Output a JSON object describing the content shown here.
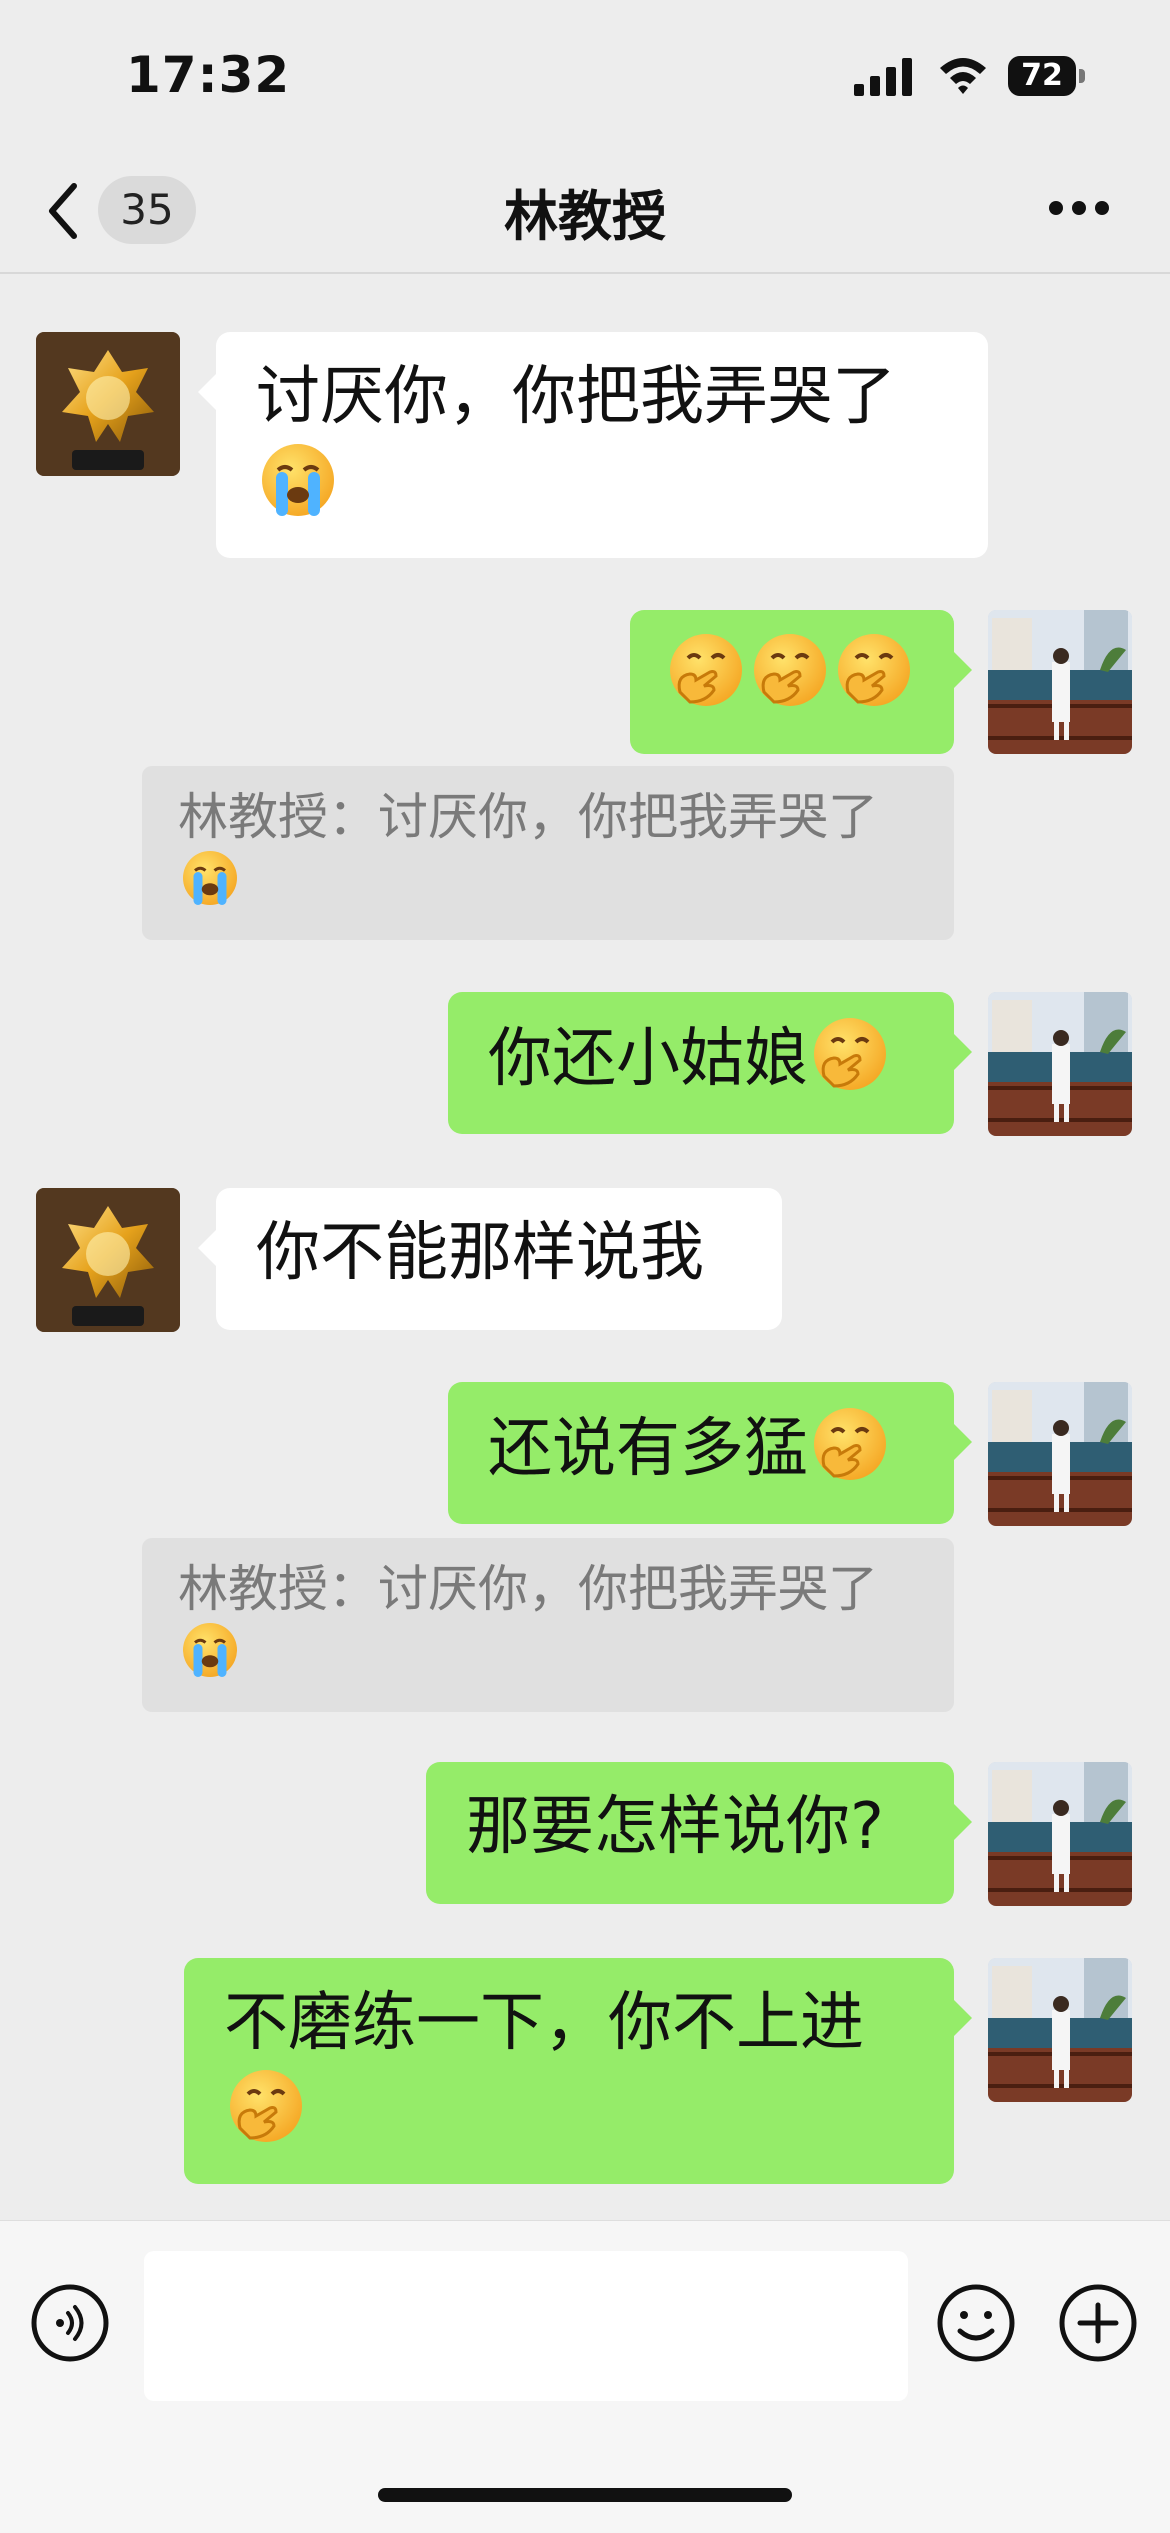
{
  "status": {
    "time": "17:32",
    "battery": "72"
  },
  "nav": {
    "unread_count": "35",
    "title": "林教授"
  },
  "messages": [
    {
      "side": "in",
      "text": "讨厌你，你把我弄哭了",
      "emoji": [
        "loudly-crying-face"
      ]
    },
    {
      "side": "out",
      "text": "",
      "emoji": [
        "face-with-hand-over-mouth",
        "face-with-hand-over-mouth",
        "face-with-hand-over-mouth"
      ]
    },
    {
      "type": "quote",
      "text": "林教授：讨厌你，你把我弄哭了",
      "emoji": [
        "loudly-crying-face"
      ]
    },
    {
      "side": "out",
      "text": "你还小姑娘",
      "emoji": [
        "face-with-hand-over-mouth"
      ]
    },
    {
      "side": "in",
      "text": "你不能那样说我",
      "emoji": []
    },
    {
      "side": "out",
      "text": "还说有多猛",
      "emoji": [
        "face-with-hand-over-mouth"
      ]
    },
    {
      "type": "quote",
      "text": "林教授：讨厌你，你把我弄哭了",
      "emoji": [
        "loudly-crying-face"
      ]
    },
    {
      "side": "out",
      "text": "那要怎样说你?",
      "emoji": []
    },
    {
      "side": "out",
      "text": "不磨练一下，你不上进",
      "emoji": [
        "face-with-hand-over-mouth"
      ]
    }
  ],
  "input": {
    "placeholder": ""
  },
  "icons": {
    "back": "chevron-left-icon",
    "more": "ellipsis-icon",
    "voice": "voice-icon",
    "emoji": "smiley-icon",
    "plus": "plus-icon"
  },
  "colors": {
    "background": "#ededed",
    "outgoing_bubble": "#95ec69",
    "incoming_bubble": "#ffffff"
  }
}
